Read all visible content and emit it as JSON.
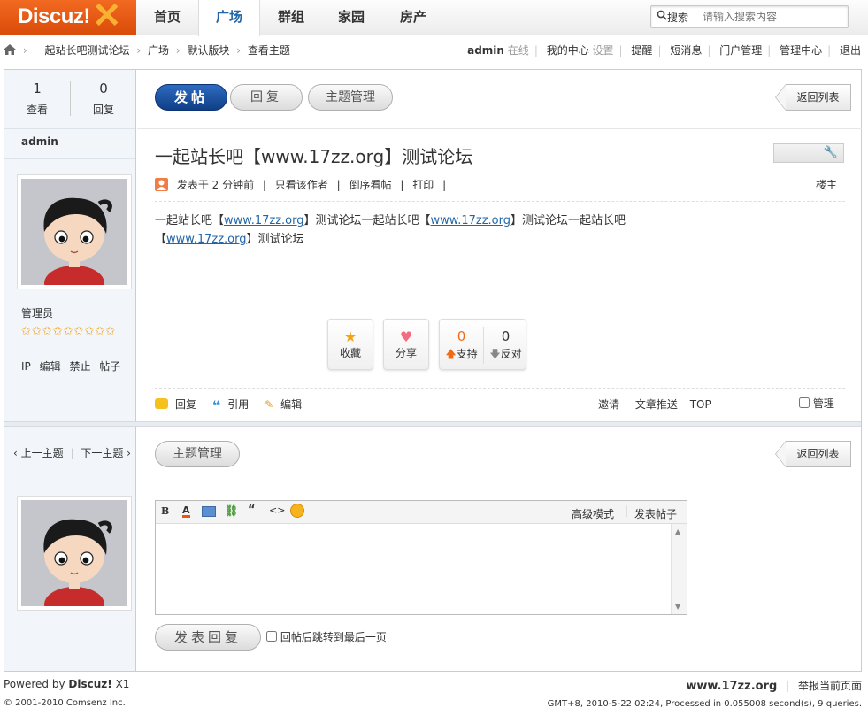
{
  "header": {
    "logo_text": "Discuz!",
    "nav": [
      "首页",
      "广场",
      "群组",
      "家园",
      "房产"
    ],
    "search_label": "搜索",
    "search_placeholder": "请输入搜索内容"
  },
  "breadcrumb": [
    "一起站长吧测试论坛",
    "广场",
    "默认版块",
    "查看主题"
  ],
  "user_bar": {
    "username": "admin",
    "status": "在线",
    "my_center": "我的中心",
    "settings": "设置",
    "links": [
      "提醒",
      "短消息",
      "门户管理",
      "管理中心",
      "退出"
    ]
  },
  "stats": {
    "views": "1",
    "views_label": "查看",
    "replies": "0",
    "replies_label": "回复"
  },
  "author": {
    "name": "admin",
    "group": "管理员",
    "stars": 9,
    "actions": [
      "IP",
      "编辑",
      "禁止",
      "帖子"
    ]
  },
  "toolbar": {
    "post": "发帖",
    "reply": "回复",
    "manage": "主题管理",
    "back": "返回列表"
  },
  "thread": {
    "title": "一起站长吧【www.17zz.org】测试论坛",
    "meta_posted": "发表于 2 分钟前",
    "meta_links": [
      "只看该作者",
      "倒序看帖",
      "打印"
    ],
    "floor": "楼主",
    "content_parts": [
      "一起站长吧【",
      "www.17zz.org",
      "】测试论坛一起站长吧【",
      "www.17zz.org",
      "】测试论坛一起站长吧",
      "【",
      "www.17zz.org",
      "】测试论坛"
    ]
  },
  "votes": {
    "favorite": "收藏",
    "share": "分享",
    "support_count": "0",
    "support_label": "支持",
    "oppose_count": "0",
    "oppose_label": "反对"
  },
  "post_actions": {
    "reply": "回复",
    "quote": "引用",
    "edit": "编辑",
    "invite": "邀请",
    "push": "文章推送",
    "top": "TOP",
    "manage": "管理"
  },
  "thread_nav": {
    "prev": "上一主题",
    "next": "下一主题"
  },
  "editor": {
    "advanced": "高级模式",
    "post_thread": "发表帖子",
    "submit": "发表回复",
    "jump_label": "回帖后跳转到最后一页",
    "tools": [
      "B",
      "A"
    ]
  },
  "footer": {
    "powered": "Powered by",
    "brand": "Discuz!",
    "version": "X1",
    "copyright": "© 2001-2010 Comsenz Inc.",
    "site": "www.17zz.org",
    "report": "举报当前页面",
    "stats": "GMT+8, 2010-5-22 02:24, Processed in 0.055008 second(s), 9 queries."
  },
  "colors": {
    "brand_orange": "#e8560f",
    "link_blue": "#2366a8",
    "sidebar_bg": "#f2f6fb"
  }
}
